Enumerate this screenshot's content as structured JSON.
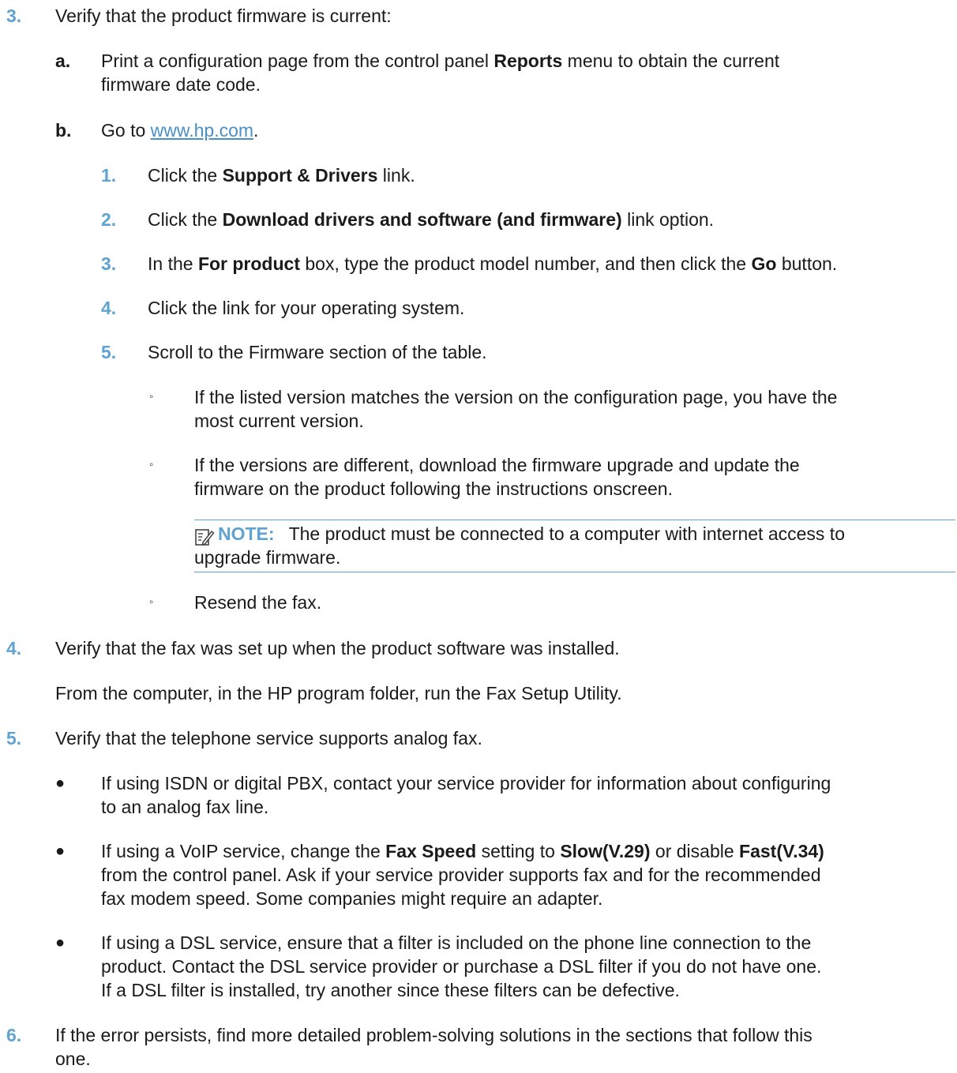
{
  "step3": {
    "num": "3.",
    "text": "Verify that the product firmware is current:",
    "a": {
      "label": "a.",
      "l1_pre": "Print a configuration page from the control panel ",
      "l1_bold": "Reports",
      "l1_post": " menu to obtain the current",
      "l2": "firmware date code."
    },
    "b": {
      "label": "b.",
      "pre": "Go to ",
      "link": "www.hp.com",
      "post": "."
    },
    "sub": [
      {
        "num": "1.",
        "pre": "Click the ",
        "bold": "Support & Drivers",
        "post": " link."
      },
      {
        "num": "2.",
        "pre": "Click the ",
        "bold": "Download drivers and software (and firmware)",
        "post": " link option."
      },
      {
        "num": "3.",
        "pre": "In the ",
        "bold": "For product",
        "mid": " box, type the product model number, and then click the ",
        "bold2": "Go",
        "post": " button."
      },
      {
        "num": "4.",
        "text": "Click the link for your operating system."
      },
      {
        "num": "5.",
        "text": "Scroll to the Firmware section of the table."
      }
    ],
    "bullets": [
      {
        "l1": "If the listed version matches the version on the configuration page, you have the",
        "l2": "most current version."
      },
      {
        "l1": "If the versions are different, download the firmware upgrade and update the",
        "l2": "firmware on the product following the instructions onscreen."
      }
    ],
    "note": {
      "label": "NOTE:",
      "l1": "The product must be connected to a computer with internet access to",
      "l2": "upgrade firmware."
    },
    "resend": "Resend the fax."
  },
  "step4": {
    "num": "4.",
    "text": "Verify that the fax was set up when the product software was installed.",
    "para": "From the computer, in the HP program folder, run the Fax Setup Utility."
  },
  "step5": {
    "num": "5.",
    "text": "Verify that the telephone service supports analog fax.",
    "b1": {
      "l1": "If using ISDN or digital PBX, contact your service provider for information about configuring",
      "l2": "to an analog fax line."
    },
    "b2": {
      "pre": "If using a VoIP service, change the ",
      "bold1": "Fax Speed",
      "mid1": " setting to ",
      "bold2": "Slow(V.29)",
      "mid2": " or disable ",
      "bold3": "Fast(V.34)",
      "l2": "from the control panel. Ask if your service provider supports fax and for the recommended",
      "l3": "fax modem speed. Some companies might require an adapter."
    },
    "b3": {
      "l1": "If using a DSL service, ensure that a filter is included on the phone line connection to the",
      "l2": "product. Contact the DSL service provider or purchase a DSL filter if you do not have one.",
      "l3": "If a DSL filter is installed, try another since these filters can be defective."
    }
  },
  "step6": {
    "num": "6.",
    "l1": "If the error persists, find more detailed problem-solving solutions in the sections that follow this",
    "l2": "one."
  }
}
